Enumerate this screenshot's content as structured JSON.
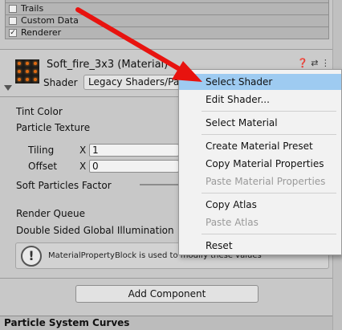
{
  "modules": [
    {
      "label": "Trails",
      "checked": false
    },
    {
      "label": "Custom Data",
      "checked": false
    },
    {
      "label": "Renderer",
      "checked": true
    }
  ],
  "material": {
    "title": "Soft_fire_3x3 (Material)",
    "shader_label": "Shader",
    "shader_value": "Legacy Shaders/Particles/Additive (Soft)"
  },
  "properties": {
    "tint_color": "Tint Color",
    "particle_texture": "Particle Texture",
    "tiling": "Tiling",
    "tiling_x_label": "X",
    "tiling_x": "1",
    "offset": "Offset",
    "offset_x_label": "X",
    "offset_x": "0",
    "soft_particles": "Soft Particles Factor",
    "render_queue": "Render Queue",
    "double_sided": "Double Sided Global Illumination"
  },
  "info": {
    "text": "MaterialPropertyBlock is used to modify these values"
  },
  "add_component": "Add Component",
  "footer_title": "Particle System Curves",
  "context_menu": {
    "items": [
      {
        "label": "Select Shader",
        "enabled": true,
        "selected": true
      },
      {
        "label": "Edit Shader...",
        "enabled": true
      },
      {
        "label": "Select Material",
        "enabled": true
      },
      {
        "label": "Create Material Preset",
        "enabled": true
      },
      {
        "label": "Copy Material Properties",
        "enabled": true
      },
      {
        "label": "Paste Material Properties",
        "enabled": false
      },
      {
        "label": "Copy Atlas",
        "enabled": true
      },
      {
        "label": "Paste Atlas",
        "enabled": false
      },
      {
        "label": "Reset",
        "enabled": true
      }
    ]
  },
  "colors": {
    "arrow": "#e8130f",
    "menu_highlight": "#9ecbf1"
  },
  "icons": [
    "checkmark-icon",
    "help-icon",
    "settings-sliders-icon",
    "kebab-menu-icon",
    "foldout-arrow-icon",
    "info-exclamation-icon"
  ]
}
